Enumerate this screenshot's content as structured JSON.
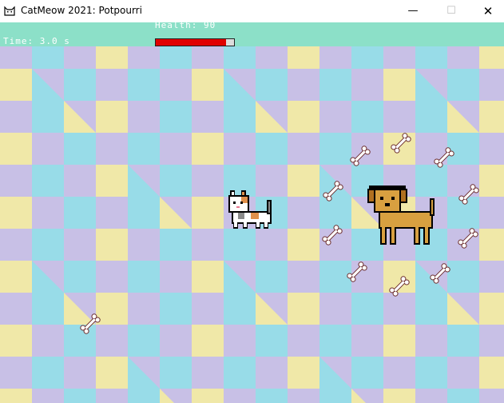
{
  "window": {
    "title": "CatMeow 2021: Potpourri",
    "minimize_glyph": "—",
    "maximize_glyph": "☐",
    "close_glyph": "✕"
  },
  "hud": {
    "health_label": "Health: 90",
    "health_value": 90,
    "health_max": 100,
    "time_label": "Time: 3.0 s"
  },
  "colors": {
    "hud_bg": "#8ce0c8",
    "tile_cyan": "#98dce8",
    "tile_lavender": "#c8c0e6",
    "tile_yellow": "#f0e8a8",
    "health_red": "#e00000"
  },
  "sprites": {
    "player": "calico-cat-sprite",
    "enemy": "brown-dog-sprite",
    "projectile": "bone-sprite"
  }
}
